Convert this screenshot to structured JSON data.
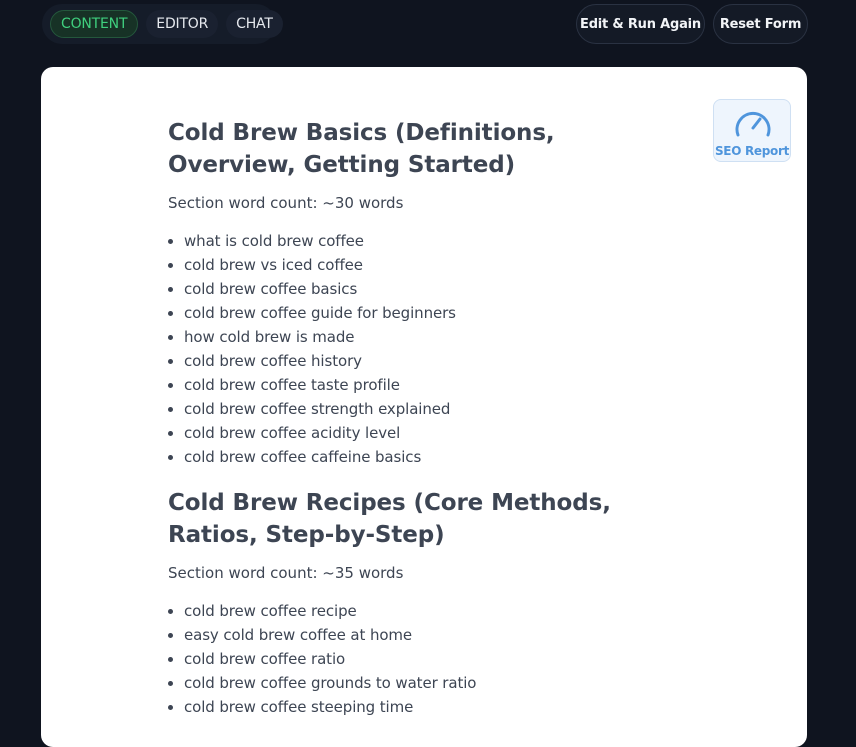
{
  "tabs": [
    {
      "label": "CONTENT",
      "active": true
    },
    {
      "label": "EDITOR",
      "active": false
    },
    {
      "label": "CHAT",
      "active": false
    }
  ],
  "actions": {
    "edit_run_label": "Edit & Run Again",
    "reset_label": "Reset Form"
  },
  "seo": {
    "label": "SEO Report",
    "icon": "gauge-icon"
  },
  "sections": [
    {
      "title": "Cold Brew Basics (Definitions, Overview, Getting Started)",
      "word_count": "Section word count: ~30 words",
      "items": [
        "what is cold brew coffee",
        "cold brew vs iced coffee",
        "cold brew coffee basics",
        "cold brew coffee guide for beginners",
        "how cold brew is made",
        "cold brew coffee history",
        "cold brew coffee taste profile",
        "cold brew coffee strength explained",
        "cold brew coffee acidity level",
        "cold brew coffee caffeine basics"
      ]
    },
    {
      "title": "Cold Brew Recipes (Core Methods, Ratios, Step-by-Step)",
      "word_count": "Section word count: ~35 words",
      "items": [
        "cold brew coffee recipe",
        "easy cold brew coffee at home",
        "cold brew coffee ratio",
        "cold brew coffee grounds to water ratio",
        "cold brew coffee steeping time"
      ]
    }
  ],
  "colors": {
    "background": "#0f141f",
    "accent_green": "#3fcf7e",
    "seo_blue": "#4f95dc",
    "text": "#3d4553"
  }
}
